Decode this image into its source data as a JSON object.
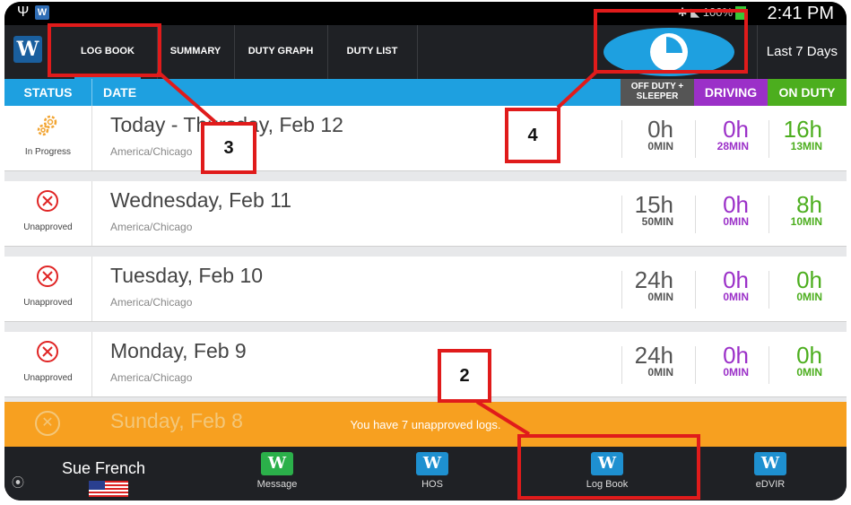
{
  "status_bar": {
    "time": "2:41 PM",
    "battery": "100%"
  },
  "app": {
    "logo": "W"
  },
  "tabs": [
    {
      "label": "LOG BOOK",
      "active": true
    },
    {
      "label": "SUMMARY",
      "active": false
    },
    {
      "label": "DUTY GRAPH",
      "active": false
    },
    {
      "label": "DUTY LIST",
      "active": false
    }
  ],
  "range": "Last 7 Days",
  "headers": {
    "status": "STATUS",
    "date": "DATE",
    "off_duty_line1": "OFF DUTY +",
    "off_duty_line2": "SLEEPER",
    "driving": "DRIVING",
    "on_duty": "ON DUTY"
  },
  "rows": [
    {
      "status": "In Progress",
      "date": "Today - Thursday, Feb 12",
      "tz": "America/Chicago",
      "off_h": "0h",
      "off_m": "0MIN",
      "drv_h": "0h",
      "drv_m": "28MIN",
      "on_h": "16h",
      "on_m": "13MIN"
    },
    {
      "status": "Unapproved",
      "date": "Wednesday, Feb 11",
      "tz": "America/Chicago",
      "off_h": "15h",
      "off_m": "50MIN",
      "drv_h": "0h",
      "drv_m": "0MIN",
      "on_h": "8h",
      "on_m": "10MIN"
    },
    {
      "status": "Unapproved",
      "date": "Tuesday, Feb 10",
      "tz": "America/Chicago",
      "off_h": "24h",
      "off_m": "0MIN",
      "drv_h": "0h",
      "drv_m": "0MIN",
      "on_h": "0h",
      "on_m": "0MIN"
    },
    {
      "status": "Unapproved",
      "date": "Monday, Feb 9",
      "tz": "America/Chicago",
      "off_h": "24h",
      "off_m": "0MIN",
      "drv_h": "0h",
      "drv_m": "0MIN",
      "on_h": "0h",
      "on_m": "0MIN"
    }
  ],
  "banner": {
    "message": "You have 7 unapproved logs.",
    "ghost_date": "Sunday, Feb 8"
  },
  "bottom": {
    "user": "Sue French",
    "nav": [
      {
        "label": "Message"
      },
      {
        "label": "HOS"
      },
      {
        "label": "Log Book"
      },
      {
        "label": "eDVIR"
      }
    ]
  },
  "callouts": [
    {
      "num": "3"
    },
    {
      "num": "4"
    },
    {
      "num": "2"
    }
  ],
  "colors": {
    "accent": "#1ea0e0",
    "driving": "#9b30c8",
    "on_duty": "#4cae1e",
    "banner": "#f7a020",
    "callout": "#e01b1b"
  }
}
